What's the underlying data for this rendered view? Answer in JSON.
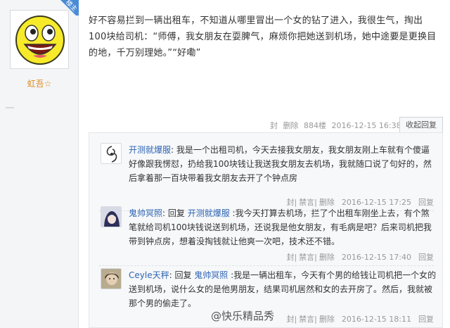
{
  "user": {
    "name": "虹吾☆",
    "badge": "楼主"
  },
  "post": {
    "text": "好不容易拦到一辆出租车，不知道从哪里冒出一个女的钻了进入，我很生气，掏出100块给司机：“师傅，我女朋友在耍脾气，麻烦你把她送到机场，她中途要是更换目的地，千万别理她。”“好嘞”",
    "meta": {
      "lock": "封",
      "delete": "删除",
      "floor": "884楼",
      "time": "2016-12-15 16:38"
    },
    "reply_toggle": "收起回复"
  },
  "replies": [
    {
      "name": "开测就爆服",
      "prefix": "",
      "reply_to": "",
      "text": ": 我是一个出租司机，今天去接我女朋友，我女朋友刚上车就有个傻逼好像跟我愣怼，扔给我100块钱让我送我女朋友去机场，我就随口说了句好的，然后拿着那一百块带着我女朋友去开了个钟点房",
      "meta": {
        "lock": "封",
        "ban": "禁言",
        "delete": "删除",
        "time": "2016-12-15 17:25",
        "reply": "回复"
      }
    },
    {
      "name": "鬼帅冥照",
      "prefix": ": 回复 ",
      "reply_to": "开测就爆服",
      "text": " :我今天打算去机场，拦了个出租车刚坐上去，有个煞笔就给司机100块钱说送到机场，还说我是他女朋友，有毛病是吧？后来司机把我带到钟点房，想着没掏钱就让他爽一次吧，技术还不错。",
      "meta": {
        "lock": "封",
        "ban": "禁言",
        "delete": "删除",
        "time": "2016-12-15 17:40",
        "reply": "回复"
      }
    },
    {
      "name": "Ceyle天秤",
      "prefix": ": 回复 ",
      "reply_to": "鬼帅冥照",
      "text": " :我是一辆出租车，今天有个男的给钱让司机把一个女的送到机场，说什么女的是他男朋友，结果司机居然和女的去开房了。然后，我就被那个男的偷走了。",
      "meta": {
        "lock": "封",
        "ban": "禁言",
        "delete": "删除",
        "time": "2016-12-15 18:11",
        "reply": "回复"
      }
    }
  ],
  "watermark": "@快乐精品秀",
  "colors": {
    "link": "#2d64b3",
    "username": "#e08a1e",
    "badge": "#4a8bd6"
  }
}
